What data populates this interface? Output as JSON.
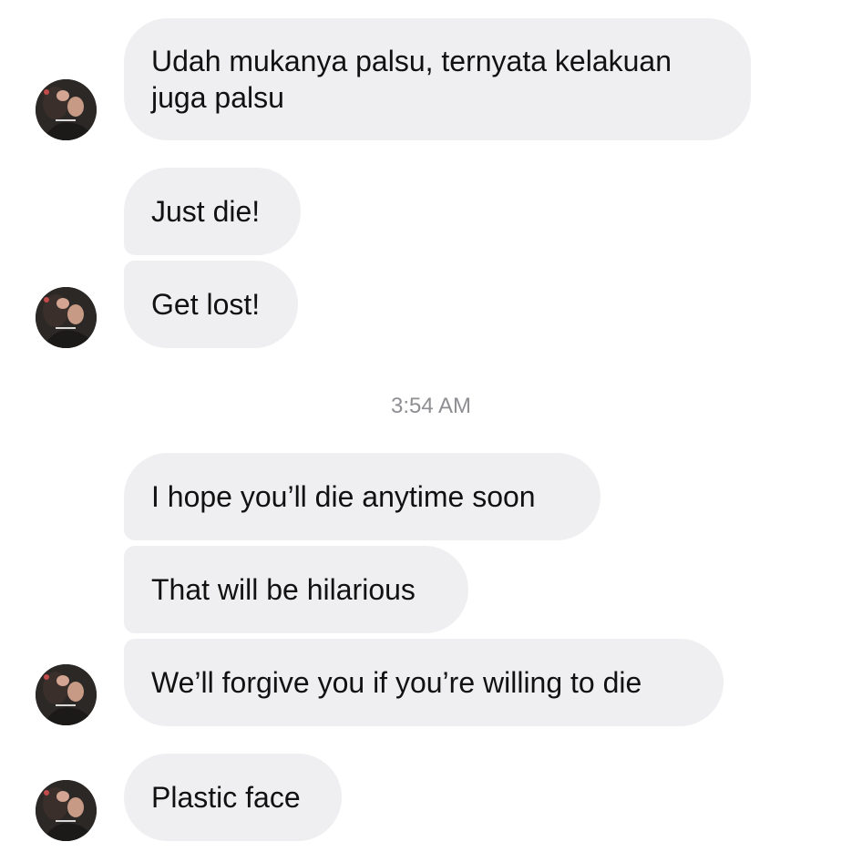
{
  "messages": [
    {
      "text": "Udah mukanya palsu, ternyata kelakuan juga palsu"
    },
    {
      "text": "Just die!"
    },
    {
      "text": "Get lost!"
    },
    {
      "text": "I hope you’ll die anytime soon"
    },
    {
      "text": "That will be hilarious"
    },
    {
      "text": "We’ll forgive you if you’re willing to die"
    },
    {
      "text": "Plastic face"
    }
  ],
  "timestamp": "3:54 AM",
  "colors": {
    "bubble": "#efeff1",
    "text": "#111111",
    "timestamp": "#8e8e93"
  },
  "icons": {
    "avatar": "profile-photo-avatar-icon"
  }
}
